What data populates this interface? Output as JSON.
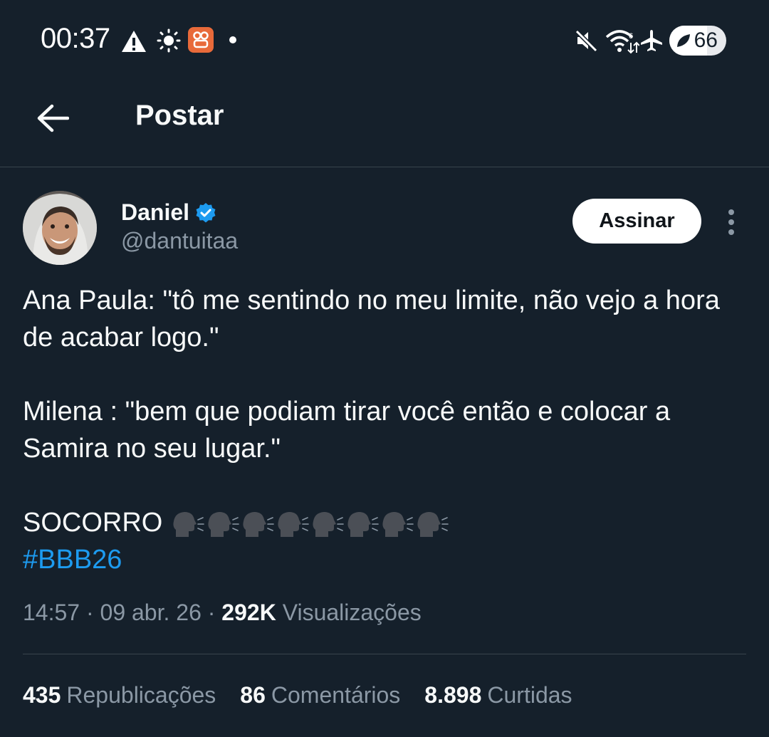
{
  "status_bar": {
    "time": "00:37",
    "battery": "66",
    "battery_level": 0.66,
    "icons": [
      "warning-icon",
      "brightness-icon",
      "app-notification-icon",
      "mute-icon",
      "wifi-icon",
      "airplane-icon"
    ]
  },
  "header": {
    "title": "Postar"
  },
  "tweet": {
    "author": {
      "name": "Daniel",
      "handle": "@dantuitaa",
      "verified": true
    },
    "subscribe_label": "Assinar",
    "lines": {
      "p1": "Ana Paula: \"tô me sentindo no meu limite, não vejo a hora de acabar logo.\"",
      "p2": "Milena : \"bem que podiam tirar você então e colocar a Samira no seu lugar.\"",
      "p3": "SOCORRO",
      "hashtag": "#BBB26"
    },
    "meta": {
      "time": "14:57",
      "separator": " · ",
      "date": "09 abr. 26",
      "views_count": "292K",
      "views_label": "Visualizações"
    },
    "stats": {
      "reposts_count": "435",
      "reposts_label": "Republicações",
      "comments_count": "86",
      "comments_label": "Comentários",
      "likes_count": "8.898",
      "likes_label": "Curtidas"
    }
  },
  "colors": {
    "background": "#15202b",
    "text": "#f7f9f9",
    "secondary": "#8b98a5",
    "accent": "#1d9bf0",
    "divider": "#38444d"
  }
}
